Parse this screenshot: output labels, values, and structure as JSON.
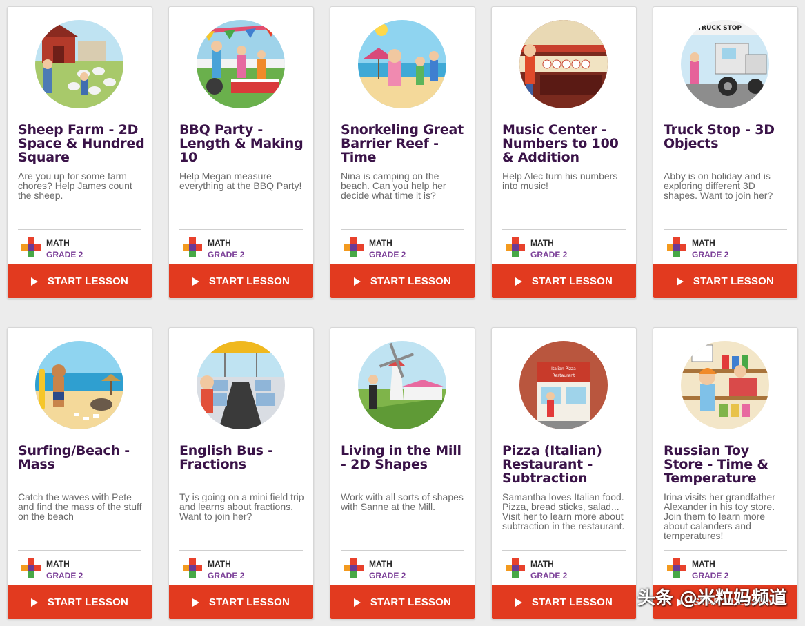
{
  "lessons": [
    {
      "title": "Sheep Farm - 2D Space & Hundred Square",
      "description": "Are you up for some farm chores? Help James count the sheep.",
      "subject": "MATH",
      "grade": "GRADE 2",
      "button": "START LESSON",
      "thumb": "farm-scene"
    },
    {
      "title": "BBQ Party - Length & Making 10",
      "description": "Help Megan measure everything at the BBQ Party!",
      "subject": "MATH",
      "grade": "GRADE 2",
      "button": "START LESSON",
      "thumb": "bbq-scene"
    },
    {
      "title": "Snorkeling Great Barrier Reef - Time",
      "description": "Nina is camping on the beach. Can you help her decide what time it is?",
      "subject": "MATH",
      "grade": "GRADE 2",
      "button": "START LESSON",
      "thumb": "beach-camp-scene"
    },
    {
      "title": "Music Center - Numbers to 100 & Addition",
      "description": "Help Alec turn his numbers into music!",
      "subject": "MATH",
      "grade": "GRADE 2",
      "button": "START LESSON",
      "thumb": "music-scene"
    },
    {
      "title": "Truck Stop - 3D Objects",
      "description": "Abby is on holiday and is exploring different 3D shapes. Want to join her?",
      "subject": "MATH",
      "grade": "GRADE 2",
      "button": "START LESSON",
      "thumb": "truck-scene",
      "sign": "TRUCK STOP"
    },
    {
      "title": "Surfing/Beach - Mass",
      "description": "Catch the waves with Pete and find the mass of the stuff on the beach",
      "subject": "MATH",
      "grade": "GRADE 2",
      "button": "START LESSON",
      "thumb": "surf-scene"
    },
    {
      "title": "English Bus - Fractions",
      "description": "Ty is going on a mini field trip and learns about fractions. Want to join her?",
      "subject": "MATH",
      "grade": "GRADE 2",
      "button": "START LESSON",
      "thumb": "bus-scene"
    },
    {
      "title": "Living in the Mill - 2D Shapes",
      "description": "Work with all sorts of shapes with Sanne at the Mill.",
      "subject": "MATH",
      "grade": "GRADE 2",
      "button": "START LESSON",
      "thumb": "mill-scene"
    },
    {
      "title": "Pizza (Italian) Restaurant - Subtraction",
      "description": "Samantha loves Italian food. Pizza, bread sticks, salad... Visit her to learn more about subtraction in the restaurant.",
      "subject": "MATH",
      "grade": "GRADE 2",
      "button": "START LESSON",
      "thumb": "pizza-scene",
      "sign": "Italian Pizza Restaurant"
    },
    {
      "title": "Russian Toy Store - Time & Temperature",
      "description": "Irina visits her grandfather Alexander in his toy store. Join them to learn more about calanders and temperatures!",
      "subject": "MATH",
      "grade": "GRADE 2",
      "button": "START LESSON",
      "thumb": "toystore-scene"
    }
  ],
  "colors": {
    "title": "#3a1348",
    "button": "#e23a1f",
    "grade": "#7b3f98",
    "plus_red": "#e8412c",
    "plus_orange": "#f39a1e",
    "plus_green": "#47a846",
    "plus_purple": "#6b3a96"
  },
  "watermark": "头条 @米粒妈频道"
}
